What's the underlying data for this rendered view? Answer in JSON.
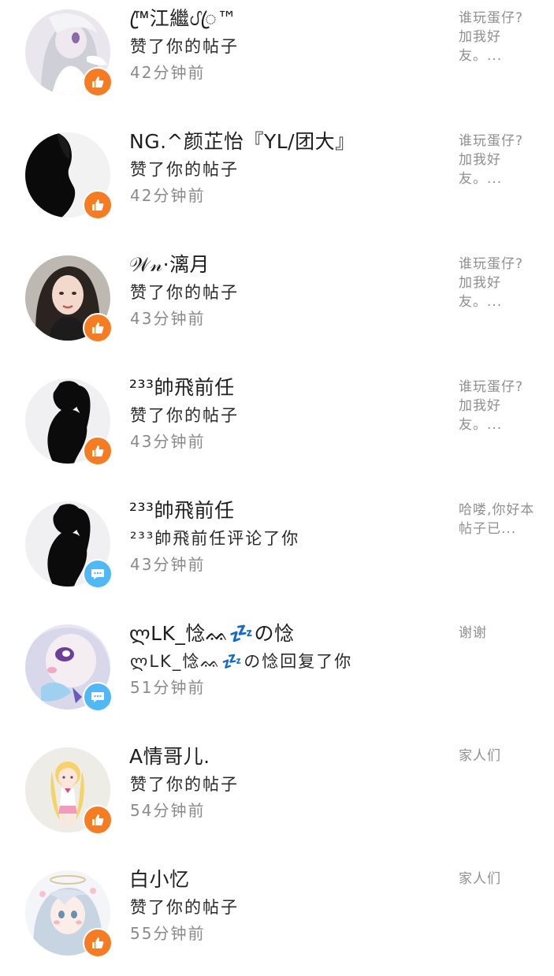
{
  "colors": {
    "like_badge": "#f57c22",
    "comment_badge": "#4fb8f5",
    "name_text": "#1e1e1e",
    "time_text": "#8a8a8a",
    "preview_text": "#8f8f8f"
  },
  "notifications": [
    {
      "name": "™ꦿ江繼ᦔꦿ™",
      "action": "赞了你的帖子",
      "time": "42分钟前",
      "preview": "谁玩蛋仔?加我好友。...",
      "badge_icon": "thumbs-up-icon",
      "avatar": "white-haired-anime-girl-avatar"
    },
    {
      "name": "NG.^颜芷怡『YL/团大』",
      "action": "赞了你的帖子",
      "time": "42分钟前",
      "preview": "谁玩蛋仔?加我好友。...",
      "badge_icon": "thumbs-up-icon",
      "avatar": "dark-silhouette-profile-avatar"
    },
    {
      "name": "𝒲𝓃·漓月",
      "action": "赞了你的帖子",
      "time": "43分钟前",
      "preview": "谁玩蛋仔?加我好友。...",
      "badge_icon": "thumbs-up-icon",
      "avatar": "girl-photo-avatar"
    },
    {
      "name": "²³³帥飛前任",
      "action": "赞了你的帖子",
      "time": "43分钟前",
      "preview": "谁玩蛋仔?加我好友。...",
      "badge_icon": "thumbs-up-icon",
      "avatar": "black-silhouette-twintails-avatar"
    },
    {
      "name": "²³³帥飛前任",
      "action": "²³³帥飛前任评论了你",
      "time": "43分钟前",
      "preview": "哈喽,你好本帖子已...",
      "badge_icon": "comment-icon",
      "avatar": "black-silhouette-twintails-avatar"
    },
    {
      "name": "ლLK_惗ᨐ💤の惗",
      "action": "ლLK_惗ᨐ💤の惗回复了你",
      "time": "51分钟前",
      "preview": "谢谢",
      "badge_icon": "comment-icon",
      "avatar": "anime-girl-purple-eye-avatar"
    },
    {
      "name": "A情哥儿.",
      "action": "赞了你的帖子",
      "time": "54分钟前",
      "preview": "家人们",
      "badge_icon": "thumbs-up-icon",
      "avatar": "blonde-twintails-chibi-avatar"
    },
    {
      "name": "白小忆",
      "action": "赞了你的帖子",
      "time": "55分钟前",
      "preview": "家人们",
      "badge_icon": "thumbs-up-icon",
      "avatar": "silver-haired-angel-avatar"
    }
  ]
}
